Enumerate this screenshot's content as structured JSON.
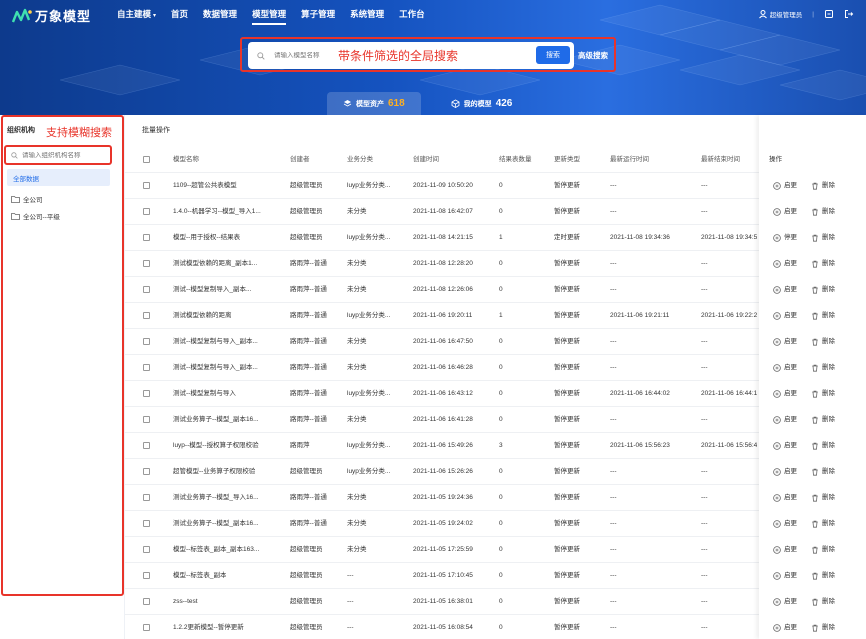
{
  "brand": {
    "name": "万象模型"
  },
  "nav": [
    {
      "label": "自主建模",
      "caret": "▾"
    },
    {
      "label": "首页"
    },
    {
      "label": "数据管理"
    },
    {
      "label": "模型管理"
    },
    {
      "label": "算子管理"
    },
    {
      "label": "系统管理"
    },
    {
      "label": "工作台"
    }
  ],
  "user": {
    "name": "超级管理员"
  },
  "search": {
    "placeholder": "请输入模型名称",
    "annotation": "带条件筛选的全局搜索",
    "button": "搜索",
    "advanced": "高级搜索"
  },
  "tabs": [
    {
      "label": "模型资产",
      "count": "618"
    },
    {
      "label": "我的模型",
      "count": "426"
    }
  ],
  "sidebar": {
    "title": "组织机构",
    "annotation": "支持模糊搜索",
    "search_placeholder": "请输入组织机构名称",
    "all_label": "全部数据",
    "items": [
      {
        "label": "全公司"
      },
      {
        "label": "全公司--平级"
      }
    ]
  },
  "main": {
    "batch_label": "批量操作",
    "columns": [
      "模型名称",
      "创建者",
      "业务分类",
      "创建时间",
      "结果表数量",
      "更新类型",
      "最新运行时间",
      "最新结束时间",
      "操作"
    ],
    "rows": [
      [
        "1109--超管公共表模型",
        "超级管理员",
        "luyp业务分类...",
        "2021-11-09 10:50:20",
        "0",
        "暂停更新",
        "---",
        "---",
        "启更",
        "删除"
      ],
      [
        "1.4.0--机器学习--模型_导入1...",
        "超级管理员",
        "未分类",
        "2021-11-08 16:42:07",
        "0",
        "暂停更新",
        "---",
        "---",
        "启更",
        "删除"
      ],
      [
        "模型--用于授权--结果表",
        "超级管理员",
        "luyp业务分类...",
        "2021-11-08 14:21:15",
        "1",
        "定时更新",
        "2021-11-08 19:34:36",
        "2021-11-08 19:34:5",
        "停更",
        "删除"
      ],
      [
        "测试模型依赖的距离_副本1...",
        "路雨萍--普通",
        "未分类",
        "2021-11-08 12:28:20",
        "0",
        "暂停更新",
        "---",
        "---",
        "启更",
        "删除"
      ],
      [
        "测试--模型复制导入_副本...",
        "路雨萍--普通",
        "未分类",
        "2021-11-08 12:26:06",
        "0",
        "暂停更新",
        "---",
        "---",
        "启更",
        "删除"
      ],
      [
        "测试模型依赖的距离",
        "路雨萍--普通",
        "luyp业务分类...",
        "2021-11-06 19:20:11",
        "1",
        "暂停更新",
        "2021-11-06 19:21:11",
        "2021-11-06 19:22:2",
        "启更",
        "删除"
      ],
      [
        "测试--模型复制与导入_副本...",
        "路雨萍--普通",
        "未分类",
        "2021-11-06 16:47:50",
        "0",
        "暂停更新",
        "---",
        "---",
        "启更",
        "删除"
      ],
      [
        "测试--模型复制与导入_副本...",
        "路雨萍--普通",
        "未分类",
        "2021-11-06 16:46:28",
        "0",
        "暂停更新",
        "---",
        "---",
        "启更",
        "删除"
      ],
      [
        "测试--模型复制与导入",
        "路雨萍--普通",
        "luyp业务分类...",
        "2021-11-06 16:43:12",
        "0",
        "暂停更新",
        "2021-11-06 16:44:02",
        "2021-11-06 16:44:1",
        "启更",
        "删除"
      ],
      [
        "测试业务算子--模型_副本16...",
        "路雨萍--普通",
        "未分类",
        "2021-11-06 16:41:28",
        "0",
        "暂停更新",
        "---",
        "---",
        "启更",
        "删除"
      ],
      [
        "luyp--模型--授权算子权限校验",
        "路雨萍",
        "luyp业务分类...",
        "2021-11-06 15:49:26",
        "3",
        "暂停更新",
        "2021-11-06 15:56:23",
        "2021-11-06 15:56:4",
        "启更",
        "删除"
      ],
      [
        "超管模型--业务算子权限校验",
        "超级管理员",
        "luyp业务分类...",
        "2021-11-06 15:26:26",
        "0",
        "暂停更新",
        "---",
        "---",
        "启更",
        "删除"
      ],
      [
        "测试业务算子--模型_导入16...",
        "路雨萍--普通",
        "未分类",
        "2021-11-05 19:24:36",
        "0",
        "暂停更新",
        "---",
        "---",
        "启更",
        "删除"
      ],
      [
        "测试业务算子--模型_副本16...",
        "路雨萍--普通",
        "未分类",
        "2021-11-05 19:24:02",
        "0",
        "暂停更新",
        "---",
        "---",
        "启更",
        "删除"
      ],
      [
        "模型--标签表_副本_副本163...",
        "超级管理员",
        "未分类",
        "2021-11-05 17:25:59",
        "0",
        "暂停更新",
        "---",
        "---",
        "启更",
        "删除"
      ],
      [
        "模型--标签表_副本",
        "超级管理员",
        "---",
        "2021-11-05 17:10:45",
        "0",
        "暂停更新",
        "---",
        "---",
        "启更",
        "删除"
      ],
      [
        "zss--test",
        "超级管理员",
        "---",
        "2021-11-05 16:38:01",
        "0",
        "暂停更新",
        "---",
        "---",
        "启更",
        "删除"
      ],
      [
        "1.2.2更新模型--暂停更新",
        "超级管理员",
        "---",
        "2021-11-05 16:08:54",
        "0",
        "暂停更新",
        "---",
        "---",
        "启更",
        "删除"
      ]
    ]
  },
  "colors": {
    "accent": "#1f6be8",
    "annotation": "#e8342a",
    "orange": "#ffb020"
  }
}
